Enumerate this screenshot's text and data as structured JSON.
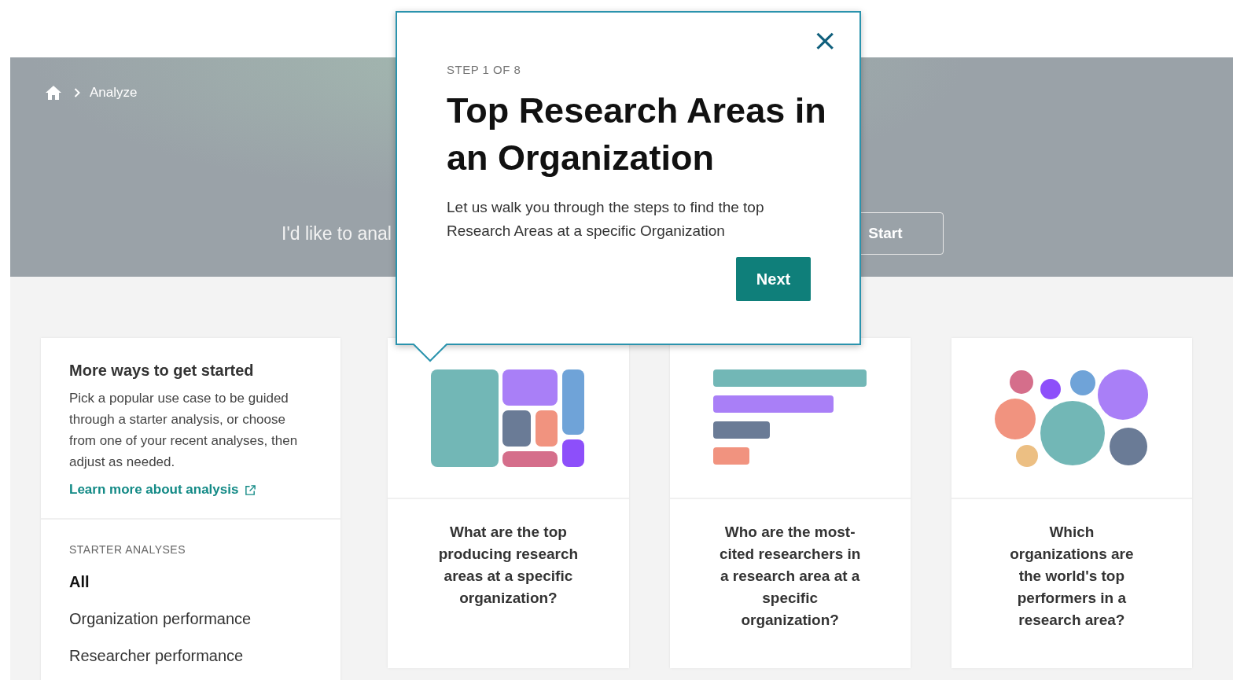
{
  "breadcrumb": {
    "current": "Analyze"
  },
  "hero": {
    "prompt": "I'd like to anal",
    "start_button": "Start"
  },
  "guide_popover": {
    "step": "STEP 1 OF 8",
    "title": "Top Research Areas in an Organization",
    "body": "Let us walk you through the steps to find the top Research Areas at a specific Organization",
    "next_button": "Next",
    "close": "×"
  },
  "sidebar": {
    "heading": "More ways to get started",
    "description": "Pick a popular use case to be guided through a starter analysis, or choose from one of your recent analyses, then adjust as needed.",
    "link": "Learn more about analysis",
    "section_label": "STARTER ANALYSES",
    "items": [
      {
        "label": "All",
        "selected": true
      },
      {
        "label": "Organization performance",
        "selected": false
      },
      {
        "label": "Researcher performance",
        "selected": false
      }
    ]
  },
  "cards": [
    {
      "kind": "treemap",
      "question": "What are the top producing research areas at a specific organization?"
    },
    {
      "kind": "bars",
      "question": "Who are the most-cited researchers in a research area at a specific organization?"
    },
    {
      "kind": "bubbles",
      "question": "Which organizations are the world's top performers in a research area?"
    }
  ]
}
